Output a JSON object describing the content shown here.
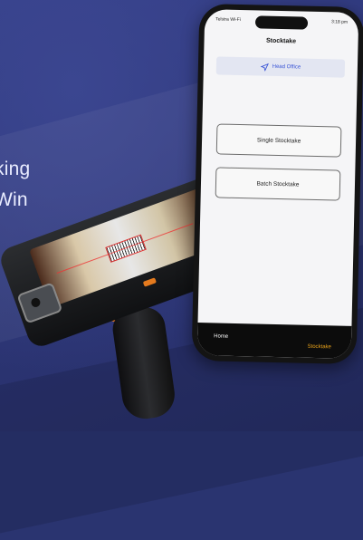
{
  "hero": {
    "line1": "king",
    "line2": "Win"
  },
  "phone": {
    "status_left": "Telstra Wi-Fi",
    "status_time": "3:18 pm",
    "title": "Stocktake",
    "branch_button": "Head Office",
    "branch_icon": "navigation-arrow-icon",
    "buttons": {
      "single": "Single Stocktake",
      "batch": "Batch Stocktake"
    },
    "tabs": {
      "home": "Home",
      "stocktake": "Stocktake"
    },
    "colors": {
      "accent": "#3b56d6",
      "active_tab": "#e8a21a"
    }
  }
}
